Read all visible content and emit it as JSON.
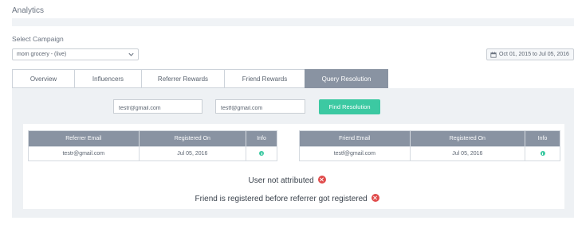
{
  "header": {
    "title": "Analytics"
  },
  "campaign": {
    "label": "Select Campaign",
    "selected": "mom grocery - (live)"
  },
  "date_range": "Oct 01, 2015 to Jul 05, 2016",
  "tabs": [
    {
      "label": "Overview",
      "active": false
    },
    {
      "label": "Influencers",
      "active": false
    },
    {
      "label": "Referrer Rewards",
      "active": false
    },
    {
      "label": "Friend Rewards",
      "active": false
    },
    {
      "label": "Query Resolution",
      "active": true
    }
  ],
  "query": {
    "referrer_email": "testr@gmail.com",
    "friend_email": "testf@gmail.com",
    "button_label": "Find Resolution"
  },
  "referrer_table": {
    "headers": [
      "Referrer Email",
      "Registered On",
      "Info"
    ],
    "row": {
      "email": "testr@gmail.com",
      "registered_on": "Jul 05, 2016"
    }
  },
  "friend_table": {
    "headers": [
      "Friend Email",
      "Registered On",
      "Info"
    ],
    "row": {
      "email": "testf@gmail.com",
      "registered_on": "Jul 05, 2016"
    }
  },
  "messages": [
    "User not attributed",
    "Friend is registered before referrer got registered"
  ],
  "colors": {
    "accent": "#3cc9a2",
    "tab_active": "#8993a2",
    "error": "#e04b4b"
  }
}
